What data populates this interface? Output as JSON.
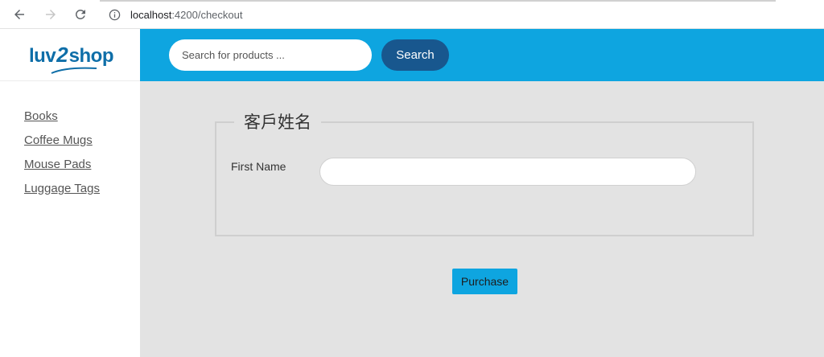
{
  "browser": {
    "url_host": "localhost",
    "url_path": ":4200/checkout",
    "icons": [
      "back-arrow-icon",
      "forward-arrow-icon",
      "reload-icon",
      "info-icon"
    ]
  },
  "logo": {
    "part1": "luv",
    "part2": "2",
    "part3": "shop",
    "color": "#0e6ea8"
  },
  "sidebar": {
    "items": [
      {
        "label": "Books"
      },
      {
        "label": "Coffee Mugs"
      },
      {
        "label": "Mouse Pads"
      },
      {
        "label": "Luggage Tags"
      }
    ]
  },
  "header": {
    "search_placeholder": "Search for products ...",
    "search_button_label": "Search",
    "background": "#0ea5e0",
    "button_color": "#18578e"
  },
  "form": {
    "legend": "客戶姓名",
    "first_name_label": "First Name",
    "first_name_value": "",
    "purchase_label": "Purchase"
  }
}
